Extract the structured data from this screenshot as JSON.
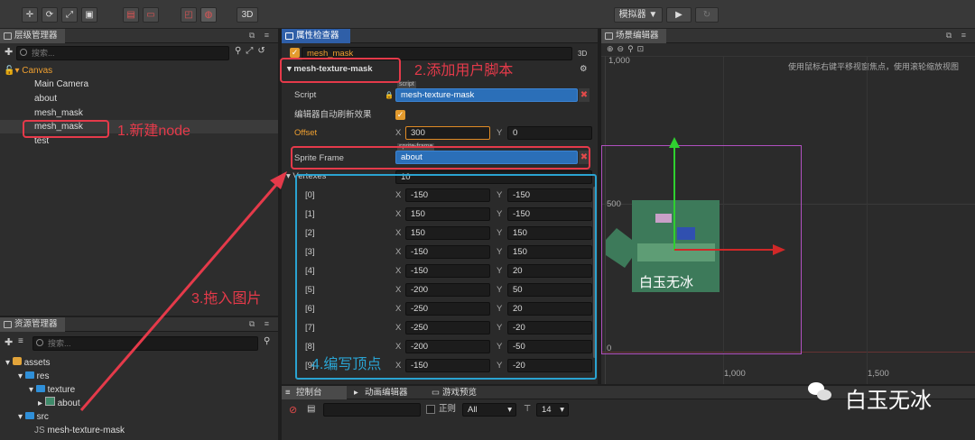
{
  "toolbar": {
    "button_3d": "3D",
    "simulator": "模拟器 ▼",
    "play": "▶",
    "refresh": "↻"
  },
  "hierarchy": {
    "title": "层级管理器",
    "search_placeholder": "搜索...",
    "root": "Canvas",
    "items": [
      "Main Camera",
      "about",
      "mesh_mask",
      "mesh_mask",
      "test"
    ]
  },
  "assets": {
    "title": "资源管理器",
    "search_placeholder": "搜索...",
    "items": [
      "assets",
      "res",
      "texture",
      "about",
      "src",
      "mesh-texture-mask"
    ]
  },
  "inspector": {
    "title": "属性检查器",
    "node_name": "mesh_mask",
    "badge_3d": "3D",
    "component": "mesh-texture-mask",
    "script_label": "Script",
    "script_tag": "script",
    "script_value": "mesh-texture-mask",
    "auto_refresh_label": "编辑器自动刷新效果",
    "offset_label": "Offset",
    "offset_x": "300",
    "offset_y": "0",
    "sprite_frame_label": "Sprite Frame",
    "sprite_frame_tag": "sprite-frame",
    "sprite_frame_value": "about",
    "vertexes_label": "Vertexes",
    "vertexes_count": "10",
    "vertexes": [
      {
        "idx": "[0]",
        "x": "-150",
        "y": "-150"
      },
      {
        "idx": "[1]",
        "x": "150",
        "y": "-150"
      },
      {
        "idx": "[2]",
        "x": "150",
        "y": "150"
      },
      {
        "idx": "[3]",
        "x": "-150",
        "y": "150"
      },
      {
        "idx": "[4]",
        "x": "-150",
        "y": "20"
      },
      {
        "idx": "[5]",
        "x": "-200",
        "y": "50"
      },
      {
        "idx": "[6]",
        "x": "-250",
        "y": "20"
      },
      {
        "idx": "[7]",
        "x": "-250",
        "y": "-20"
      },
      {
        "idx": "[8]",
        "x": "-200",
        "y": "-50"
      },
      {
        "idx": "[9]",
        "x": "-150",
        "y": "-20"
      }
    ],
    "x_label": "X",
    "y_label": "Y"
  },
  "scene": {
    "title": "场景编辑器",
    "hint": "使用鼠标右键平移视窗焦点，使用滚轮缩放视图",
    "tick_1000_top": "1,000",
    "tick_500": "500",
    "tick_0": "0",
    "tick_1000_bottom": "1,000",
    "tick_1500": "1,500",
    "image_caption": "白玉无冰"
  },
  "console": {
    "tabs": [
      "控制台",
      "动画编辑器",
      "游戏预览"
    ],
    "regex_label": "正则",
    "filter_value": "All",
    "font_size": "14"
  },
  "annotations": {
    "step1": "1.新建node",
    "step2": "2.添加用户脚本",
    "step3": "3.拖入图片",
    "step4": "4.编写顶点"
  },
  "watermark": {
    "text": "白玉无冰"
  },
  "colors": {
    "accent_blue": "#2f5fa8",
    "annotation_red": "#e53a4a",
    "annotation_blue": "#2aa3d1",
    "orange": "#f0a030"
  }
}
